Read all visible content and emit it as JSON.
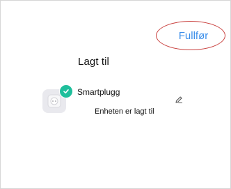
{
  "header": {
    "done_label": "Fullfør"
  },
  "main": {
    "title": "Lagt til",
    "device": {
      "name": "Smartplugg",
      "status": "Enheten er lagt til",
      "icon": "smart-plug-icon",
      "badge_icon": "check-icon",
      "badge_color": "#1fbf9c",
      "edit_icon": "pencil-icon"
    }
  },
  "colors": {
    "accent": "#3a8eea",
    "highlight_ring": "#c9413f"
  }
}
